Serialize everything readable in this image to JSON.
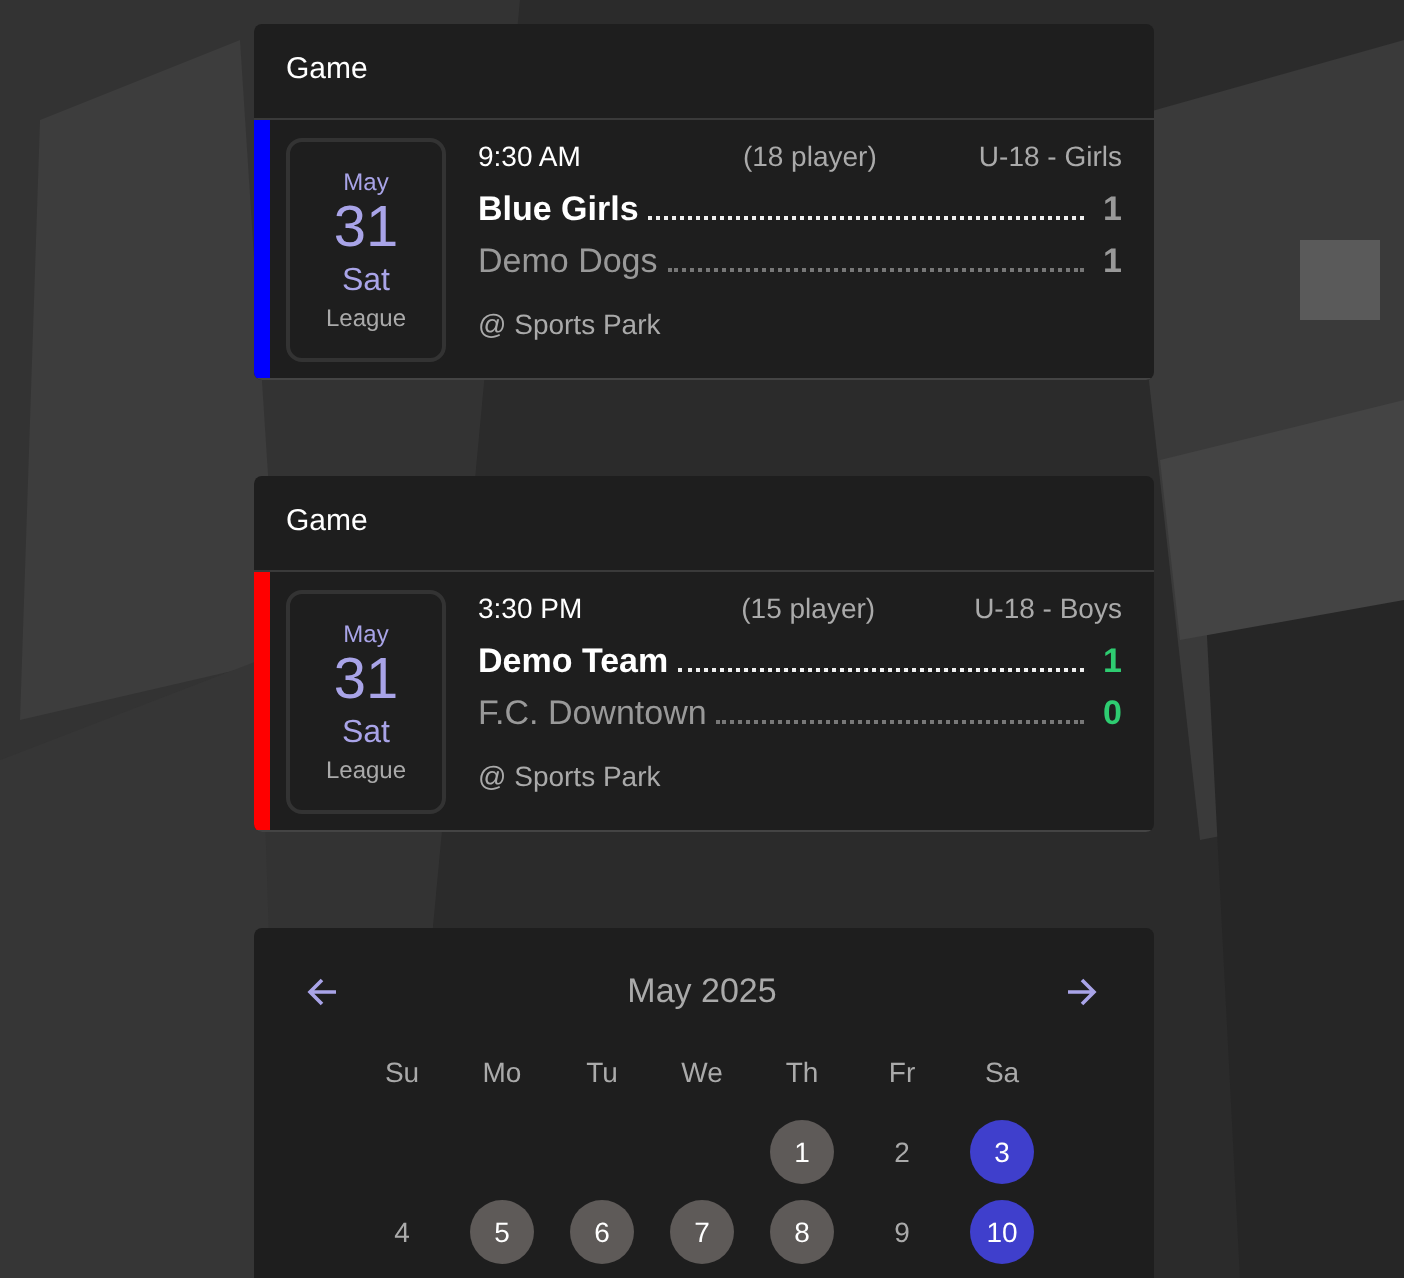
{
  "games": [
    {
      "header": "Game",
      "color": "#0000ff",
      "scores_highlighted": false,
      "month": "May",
      "day": "31",
      "weekday": "Sat",
      "type": "League",
      "time": "9:30 AM",
      "players": "(18 player)",
      "division": "U-18 - Girls",
      "teams": [
        {
          "kind": "home",
          "name": "Blue Girls",
          "score": "1"
        },
        {
          "kind": "away",
          "name": "Demo Dogs",
          "score": "1"
        }
      ],
      "location": "@ Sports Park"
    },
    {
      "header": "Game",
      "color": "#ff0000",
      "scores_highlighted": true,
      "month": "May",
      "day": "31",
      "weekday": "Sat",
      "type": "League",
      "time": "3:30 PM",
      "players": "(15 player)",
      "division": "U-18 - Boys",
      "teams": [
        {
          "kind": "home",
          "name": "Demo Team",
          "score": "1"
        },
        {
          "kind": "away",
          "name": "F.C. Downtown",
          "score": "0"
        }
      ],
      "location": "@ Sports Park"
    }
  ],
  "calendar": {
    "title": "May 2025",
    "weekdays": [
      "Su",
      "Mo",
      "Tu",
      "We",
      "Th",
      "Fr",
      "Sa"
    ],
    "weeks": [
      [
        {
          "kind": "empty"
        },
        {
          "kind": "empty"
        },
        {
          "kind": "empty"
        },
        {
          "kind": "empty"
        },
        {
          "kind": "event",
          "label": "1"
        },
        {
          "kind": "plain",
          "label": "2"
        },
        {
          "kind": "marked",
          "label": "3"
        }
      ],
      [
        {
          "kind": "plain",
          "label": "4"
        },
        {
          "kind": "event",
          "label": "5"
        },
        {
          "kind": "event",
          "label": "6"
        },
        {
          "kind": "event",
          "label": "7"
        },
        {
          "kind": "event",
          "label": "8"
        },
        {
          "kind": "plain",
          "label": "9"
        },
        {
          "kind": "marked",
          "label": "10"
        }
      ]
    ]
  }
}
